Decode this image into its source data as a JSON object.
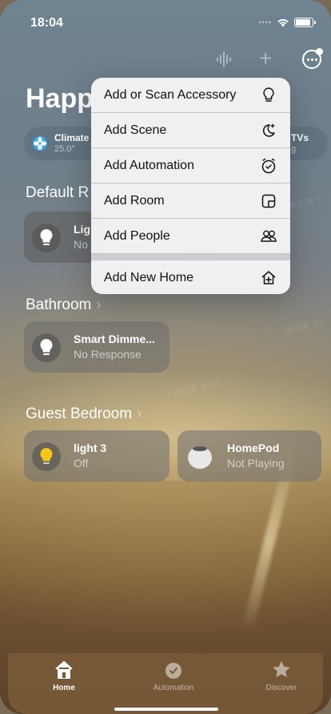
{
  "status_bar": {
    "time": "18:04"
  },
  "home": {
    "title": "Happ"
  },
  "chips": [
    {
      "title": "Climate",
      "subtitle": "25.0°"
    },
    {
      "title": "TVs",
      "subtitle": "g"
    }
  ],
  "sections": [
    {
      "label": "Default R"
    },
    {
      "label": "Bathroom"
    },
    {
      "label": "Guest Bedroom"
    }
  ],
  "tiles": {
    "default": {
      "name": "Lig",
      "state": "No"
    },
    "bathroom": {
      "name": "Smart Dimme...",
      "state": "No Response"
    },
    "guest1": {
      "name": "light 3",
      "state": "Off"
    },
    "guest2": {
      "name": "HomePod",
      "state": "Not Playing"
    }
  },
  "menu": {
    "items": [
      {
        "label": "Add or Scan Accessory",
        "icon": "bulb-icon"
      },
      {
        "label": "Add Scene",
        "icon": "scene-icon"
      },
      {
        "label": "Add Automation",
        "icon": "clock-icon"
      },
      {
        "label": "Add Room",
        "icon": "room-icon"
      },
      {
        "label": "Add People",
        "icon": "people-icon"
      }
    ],
    "new_home": {
      "label": "Add New Home",
      "icon": "home-plus-icon"
    }
  },
  "tabbar": {
    "tabs": [
      {
        "label": "Home",
        "icon": "home-icon",
        "active": true
      },
      {
        "label": "Automation",
        "icon": "automation-icon",
        "active": false
      },
      {
        "label": "Discover",
        "icon": "star-icon",
        "active": false
      }
    ]
  },
  "colors": {
    "menu_bg": "#f4f4f6",
    "light_on": "#f5c518",
    "tab_bg": "#785a37"
  }
}
